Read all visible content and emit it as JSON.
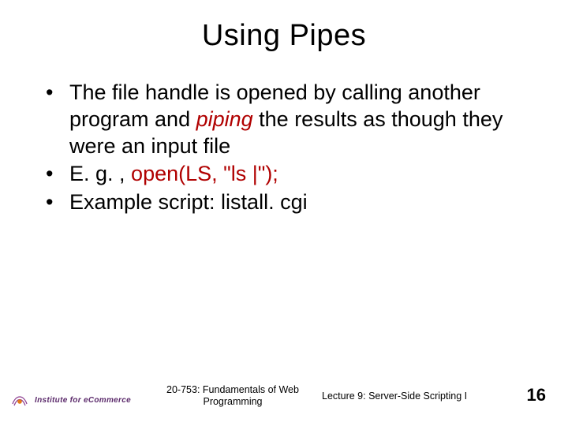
{
  "title": "Using Pipes",
  "bullets": {
    "b1_a": "The file handle is opened by calling another program and ",
    "b1_em": "piping",
    "b1_b": " the results as though they were an input file",
    "b2_a": "E. g. , ",
    "b2_code": "open(LS, \"ls |\");",
    "b3": "Example script: listall. cgi"
  },
  "footer": {
    "logo_text": "Institute for eCommerce",
    "course": "20-753: Fundamentals of Web Programming",
    "lecture": "Lecture 9: Server-Side Scripting I",
    "page": "16"
  }
}
